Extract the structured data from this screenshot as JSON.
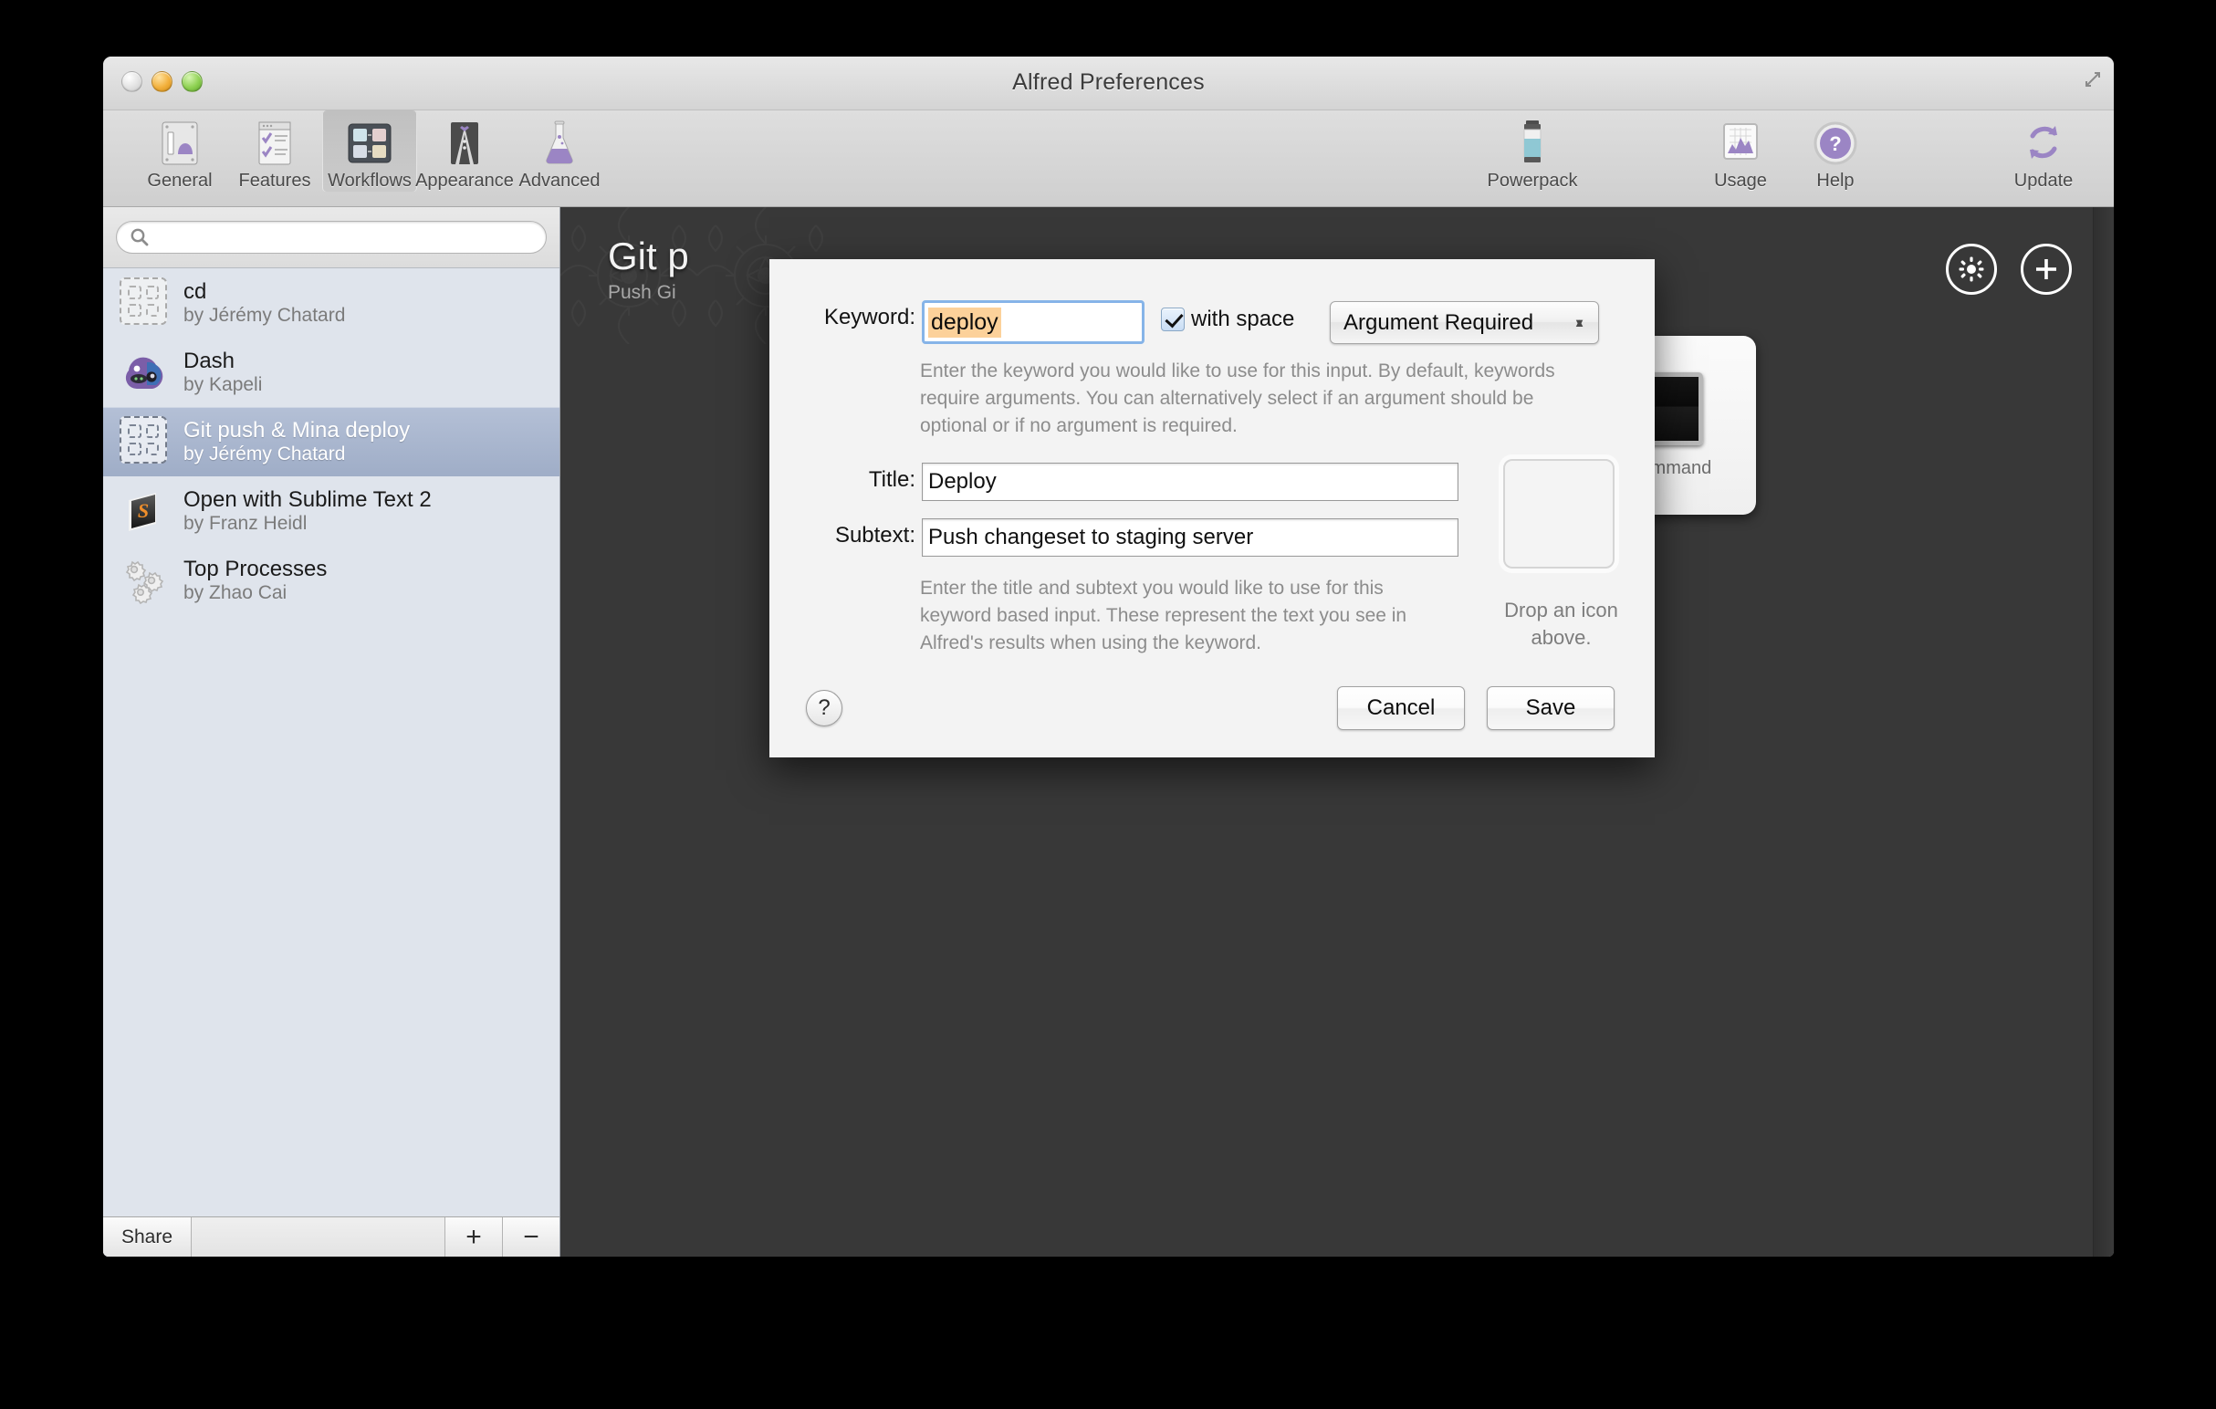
{
  "window": {
    "title": "Alfred Preferences",
    "traffic_lights": [
      "close-button",
      "minimize-button",
      "zoom-button"
    ],
    "resize_grip": "⤢"
  },
  "toolbar": {
    "left_items": [
      {
        "label": "General",
        "icon": "general-icon"
      },
      {
        "label": "Features",
        "icon": "features-icon"
      },
      {
        "label": "Workflows",
        "icon": "workflows-icon",
        "selected": true
      },
      {
        "label": "Appearance",
        "icon": "appearance-icon"
      },
      {
        "label": "Advanced",
        "icon": "advanced-icon"
      }
    ],
    "right_items": [
      {
        "label": "Powerpack",
        "icon": "powerpack-battery-icon"
      },
      {
        "label": "Usage",
        "icon": "usage-chart-icon"
      },
      {
        "label": "Help",
        "icon": "help-question-icon"
      },
      {
        "label": "Update",
        "icon": "update-refresh-icon"
      }
    ]
  },
  "sidebar": {
    "search": {
      "value": "",
      "placeholder": ""
    },
    "workflows": [
      {
        "name": "cd",
        "author": "by Jérémy Chatard",
        "icon": "placeholder-workflow-icon",
        "selected": false
      },
      {
        "name": "Dash",
        "author": "by Kapeli",
        "icon": "dash-app-icon",
        "selected": false
      },
      {
        "name": "Git push & Mina deploy",
        "author": "by Jérémy Chatard",
        "icon": "placeholder-workflow-icon",
        "selected": true
      },
      {
        "name": "Open with Sublime Text 2",
        "author": "by Franz Heidl",
        "icon": "sublime-text-icon",
        "selected": false
      },
      {
        "name": "Top Processes",
        "author": "by Zhao Cai",
        "icon": "gears-icon",
        "selected": false
      }
    ],
    "bottom": {
      "share_label": "Share",
      "add_label": "+",
      "remove_label": "−"
    }
  },
  "canvas": {
    "workflow_title": "Git p",
    "workflow_subtitle": "Push Gi",
    "actions": [
      {
        "name": "settings-gear-button",
        "icon": "gear-icon"
      },
      {
        "name": "add-object-button",
        "icon": "plus-icon"
      }
    ],
    "node": {
      "label": "nal Command",
      "icon": "terminal-icon"
    }
  },
  "sheet": {
    "keyword": {
      "label": "Keyword:",
      "value": "deploy",
      "with_space_label": "with space",
      "with_space_checked": true,
      "argument_mode": "Argument Required",
      "help": "Enter the keyword you would like to use for this input. By default, keywords require arguments. You can alternatively select if an argument should be optional or if no argument is required."
    },
    "title": {
      "label": "Title:",
      "value": "Deploy"
    },
    "subtext": {
      "label": "Subtext:",
      "value": "Push changeset to staging server"
    },
    "fields_help": "Enter the title and subtext you would like to use for this keyword based input. These represent the text you see in Alfred's results when using the keyword.",
    "icon_well_caption": "Drop an\nicon above.",
    "help_button_label": "?",
    "cancel_label": "Cancel",
    "save_label": "Save"
  },
  "colors": {
    "selection_blue": "#9fadc7",
    "text_highlight": "#fcd19a",
    "focus_ring": "#86b4e8",
    "canvas_bg": "#383838",
    "accent_purple": "#9b85c4"
  }
}
